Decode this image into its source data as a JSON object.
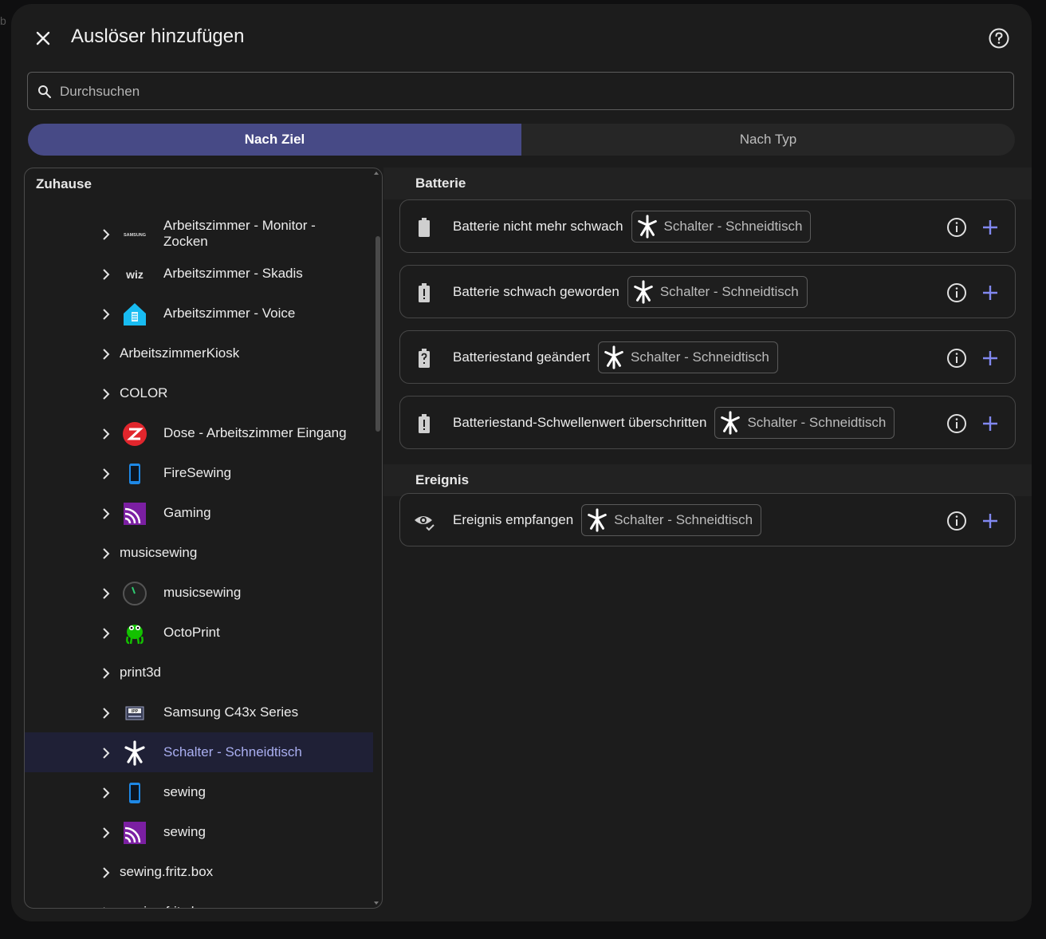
{
  "dialog": {
    "title": "Auslöser hinzufügen",
    "search_placeholder": "Durchsuchen",
    "tabs": [
      {
        "label": "Nach Ziel",
        "active": true
      },
      {
        "label": "Nach Typ",
        "active": false
      }
    ]
  },
  "tree": {
    "header": "Zuhause",
    "items": [
      {
        "label": "Arbeitszimmer - Monitor - Zocken",
        "icon": "samsung-logo-icon"
      },
      {
        "label": "Arbeitszimmer - Skadis",
        "icon": "wiz-logo-icon"
      },
      {
        "label": "Arbeitszimmer - Voice",
        "icon": "home-assistant-icon"
      },
      {
        "label": "ArbeitszimmerKiosk",
        "icon": ""
      },
      {
        "label": "COLOR",
        "icon": ""
      },
      {
        "label": "Dose - Arbeitszimmer Eingang",
        "icon": "zwave-icon"
      },
      {
        "label": "FireSewing",
        "icon": "phone-icon"
      },
      {
        "label": "Gaming",
        "icon": "cast-icon"
      },
      {
        "label": "musicsewing",
        "icon": ""
      },
      {
        "label": "musicsewing",
        "icon": "gauge-icon"
      },
      {
        "label": "OctoPrint",
        "icon": "octoprint-icon"
      },
      {
        "label": "print3d",
        "icon": ""
      },
      {
        "label": "Samsung C43x Series",
        "icon": "ipp-printer-icon"
      },
      {
        "label": "Schalter - Schneidtisch",
        "icon": "zigbee-icon",
        "selected": true
      },
      {
        "label": "sewing",
        "icon": "phone-icon"
      },
      {
        "label": "sewing",
        "icon": "cast-icon"
      },
      {
        "label": "sewing.fritz.box",
        "icon": ""
      },
      {
        "label": "sewing.fritz.box",
        "icon": ""
      }
    ]
  },
  "sections": [
    {
      "title": "Batterie",
      "triggers": [
        {
          "label": "Batterie nicht mehr schwach",
          "icon": "battery-full-icon",
          "chip": "Schalter - Schneidtisch"
        },
        {
          "label": "Batterie schwach geworden",
          "icon": "battery-alert-icon",
          "chip": "Schalter - Schneidtisch"
        },
        {
          "label": "Batteriestand geändert",
          "icon": "battery-unknown-icon",
          "chip": "Schalter - Schneidtisch"
        },
        {
          "label": "Batteriestand-Schwellenwert überschritten",
          "icon": "battery-alert-icon",
          "chip": "Schalter - Schneidtisch"
        }
      ]
    },
    {
      "title": "Ereignis",
      "triggers": [
        {
          "label": "Ereignis empfangen",
          "icon": "eye-check-icon",
          "chip": "Schalter - Schneidtisch"
        }
      ]
    }
  ],
  "colors": {
    "accent": "#474a86",
    "accent_text": "#a9aef0",
    "add_icon": "#8188f0"
  }
}
